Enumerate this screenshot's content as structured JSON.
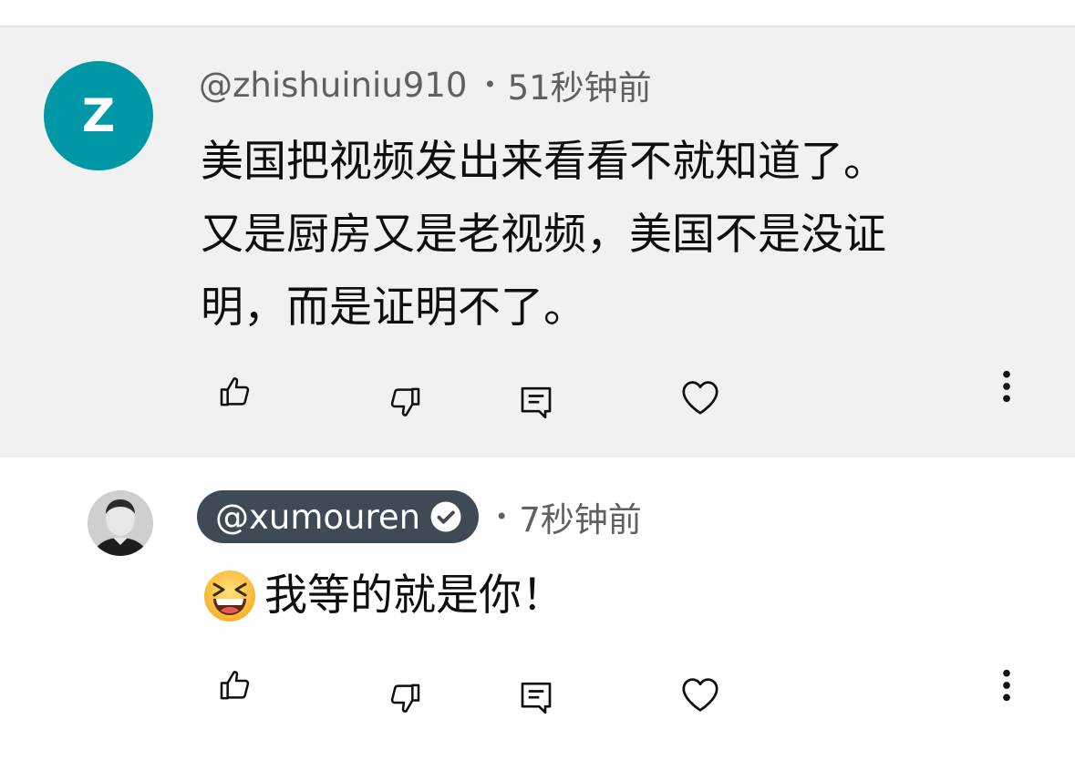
{
  "comments": [
    {
      "avatar_letter": "Z",
      "avatar_color": "#0097a7",
      "author": "@zhishuiniu910",
      "separator": "•",
      "time": "51秒钟前",
      "text_lines": [
        "美国把视频发出来看看不就知道了。",
        "又是厨房又是老视频，美国不是没证",
        "明，而是证明不了。"
      ],
      "actions": [
        "like-icon",
        "dislike-icon",
        "reply-icon",
        "heart-icon",
        "more-icon"
      ]
    },
    {
      "author": "@xumouren",
      "author_chip_color": "#3f4a56",
      "verified": true,
      "separator": "•",
      "time": "7秒钟前",
      "emoji": "grinning-squinting-face-emoji",
      "text": "我等的就是你！",
      "actions": [
        "like-icon",
        "dislike-icon",
        "reply-icon",
        "heart-icon",
        "more-icon"
      ]
    }
  ]
}
